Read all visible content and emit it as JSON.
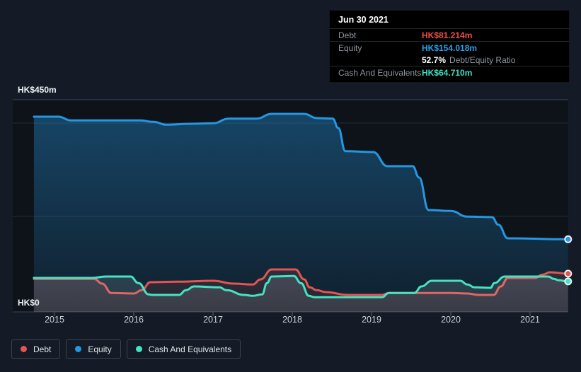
{
  "tooltip": {
    "date": "Jun 30 2021",
    "debt": {
      "label": "Debt",
      "value": "HK$81.214m"
    },
    "equity": {
      "label": "Equity",
      "value": "HK$154.018m"
    },
    "ratio": {
      "value": "52.7%",
      "label": "Debt/Equity Ratio"
    },
    "cash": {
      "label": "Cash And Equivalents",
      "value": "HK$64.710m"
    }
  },
  "chart": {
    "y_axis": {
      "top_label": "HK$450m",
      "bottom_label": "HK$0"
    },
    "x_ticks": [
      "2015",
      "2016",
      "2017",
      "2018",
      "2019",
      "2020",
      "2021"
    ]
  },
  "legend": {
    "items": [
      {
        "label": "Debt",
        "color": "#e25550"
      },
      {
        "label": "Equity",
        "color": "#2696e2"
      },
      {
        "label": "Cash And Equivalents",
        "color": "#46e2c2"
      }
    ]
  },
  "colors": {
    "debt": "#e25550",
    "equity": "#2696e2",
    "cash_line": "#46e2c2",
    "cash_fill": "#c8dce1",
    "background": "#151b26",
    "plot_background": "#0d1319"
  },
  "chart_data": {
    "type": "area",
    "title": "Debt to Equity History",
    "unit": "HK$ millions",
    "x_range": [
      2014.74,
      2021.5
    ],
    "ylim": [
      0,
      450
    ],
    "x_tick_years": [
      2015,
      2016,
      2017,
      2018,
      2019,
      2020,
      2021
    ],
    "series": [
      {
        "name": "Debt",
        "color": "#e25550",
        "fill": "#e25550",
        "points": [
          [
            2014.74,
            70
          ],
          [
            2015.5,
            70
          ],
          [
            2015.6,
            60
          ],
          [
            2015.72,
            40
          ],
          [
            2016.0,
            39
          ],
          [
            2016.1,
            46
          ],
          [
            2016.21,
            63
          ],
          [
            2016.57,
            64
          ],
          [
            2017.0,
            66
          ],
          [
            2017.26,
            60
          ],
          [
            2017.5,
            58
          ],
          [
            2017.6,
            69
          ],
          [
            2017.74,
            90
          ],
          [
            2018.04,
            90
          ],
          [
            2018.15,
            69
          ],
          [
            2018.22,
            52
          ],
          [
            2018.31,
            46
          ],
          [
            2018.42,
            42
          ],
          [
            2018.7,
            36
          ],
          [
            2019.13,
            36
          ],
          [
            2019.22,
            40
          ],
          [
            2020.0,
            40
          ],
          [
            2020.21,
            39
          ],
          [
            2020.35,
            36
          ],
          [
            2020.54,
            36
          ],
          [
            2020.63,
            54
          ],
          [
            2020.72,
            72
          ],
          [
            2021.06,
            72
          ],
          [
            2021.16,
            79
          ],
          [
            2021.25,
            84
          ],
          [
            2021.48,
            81.2
          ]
        ]
      },
      {
        "name": "Equity",
        "color": "#2696e2",
        "fill": "#2696e2",
        "points": [
          [
            2014.74,
            414
          ],
          [
            2015.05,
            414
          ],
          [
            2015.21,
            406
          ],
          [
            2016.08,
            406
          ],
          [
            2016.25,
            403
          ],
          [
            2016.41,
            397
          ],
          [
            2016.72,
            399
          ],
          [
            2017.0,
            400
          ],
          [
            2017.2,
            410
          ],
          [
            2017.55,
            410
          ],
          [
            2017.74,
            420
          ],
          [
            2018.15,
            420
          ],
          [
            2018.31,
            411
          ],
          [
            2018.51,
            410
          ],
          [
            2018.58,
            390
          ],
          [
            2018.67,
            341
          ],
          [
            2019.02,
            339
          ],
          [
            2019.2,
            309
          ],
          [
            2019.52,
            309
          ],
          [
            2019.6,
            285
          ],
          [
            2019.72,
            216
          ],
          [
            2020.0,
            214
          ],
          [
            2020.21,
            202
          ],
          [
            2020.52,
            201
          ],
          [
            2020.6,
            185
          ],
          [
            2020.72,
            156
          ],
          [
            2021.48,
            154
          ]
        ]
      },
      {
        "name": "Cash And Equivalents",
        "color": "#46e2c2",
        "fill": "#c8dce1",
        "points": [
          [
            2014.74,
            72
          ],
          [
            2015.47,
            72
          ],
          [
            2015.65,
            75
          ],
          [
            2015.96,
            75
          ],
          [
            2016.06,
            61
          ],
          [
            2016.19,
            37
          ],
          [
            2016.23,
            36
          ],
          [
            2016.57,
            36
          ],
          [
            2016.66,
            46
          ],
          [
            2016.76,
            54
          ],
          [
            2017.08,
            52
          ],
          [
            2017.17,
            46
          ],
          [
            2017.39,
            36
          ],
          [
            2017.5,
            34
          ],
          [
            2017.62,
            37
          ],
          [
            2017.68,
            61
          ],
          [
            2017.74,
            75
          ],
          [
            2018.02,
            76
          ],
          [
            2018.11,
            61
          ],
          [
            2018.21,
            34
          ],
          [
            2018.28,
            31
          ],
          [
            2019.13,
            31
          ],
          [
            2019.22,
            40
          ],
          [
            2019.54,
            40
          ],
          [
            2019.63,
            54
          ],
          [
            2019.76,
            66
          ],
          [
            2020.12,
            66
          ],
          [
            2020.21,
            58
          ],
          [
            2020.3,
            52
          ],
          [
            2020.5,
            51
          ],
          [
            2020.55,
            61
          ],
          [
            2020.68,
            75
          ],
          [
            2021.23,
            75
          ],
          [
            2021.3,
            70
          ],
          [
            2021.36,
            67
          ],
          [
            2021.48,
            64.7
          ]
        ]
      }
    ],
    "legend_position": "bottom",
    "grid": true
  }
}
